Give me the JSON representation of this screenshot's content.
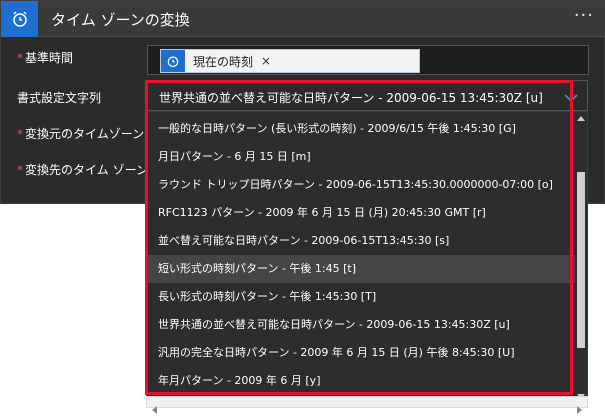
{
  "header": {
    "title": "タイム ゾーンの変換",
    "more_label": "···",
    "icon": "alarm-clock-icon"
  },
  "fields": {
    "base_time_label": "基準時間",
    "format_string_label": "書式設定文字列",
    "source_tz_label": "変換元のタイムゾーン",
    "dest_tz_label": "変換先のタイム ゾーン",
    "required_marker": "*"
  },
  "token": {
    "label": "現在の時刻",
    "remove_label": "×",
    "icon": "alarm-clock-icon"
  },
  "dropdown": {
    "selected": "世界共通の並べ替え可能な日時パターン - 2009-06-15 13:45:30Z [u]",
    "options": [
      "一般的な日時パターン (長い形式の時刻) - 2009/6/15 午後 1:45:30 [G]",
      "月日パターン - 6 月 15 日 [m]",
      "ラウンド トリップ日時パターン - 2009-06-15T13:45:30.0000000-07:00 [o]",
      "RFC1123 パターン - 2009 年 6 月 15 日 (月) 20:45:30 GMT [r]",
      "並べ替え可能な日時パターン - 2009-06-15T13:45:30 [s]",
      "短い形式の時刻パターン - 午後 1:45 [t]",
      "長い形式の時刻パターン - 午後 1:45:30 [T]",
      "世界共通の並べ替え可能な日時パターン - 2009-06-15 13:45:30Z [u]",
      "汎用の完全な日時パターン - 2009 年 6 月 15 日 (月) 午後 8:45:30 [U]",
      "年月パターン - 2009 年 6 月 [y]"
    ],
    "hovered_index": 5
  },
  "colors": {
    "accent": "#1f6fd1",
    "highlight_outline": "#e8112d",
    "required": "#e8515b"
  }
}
